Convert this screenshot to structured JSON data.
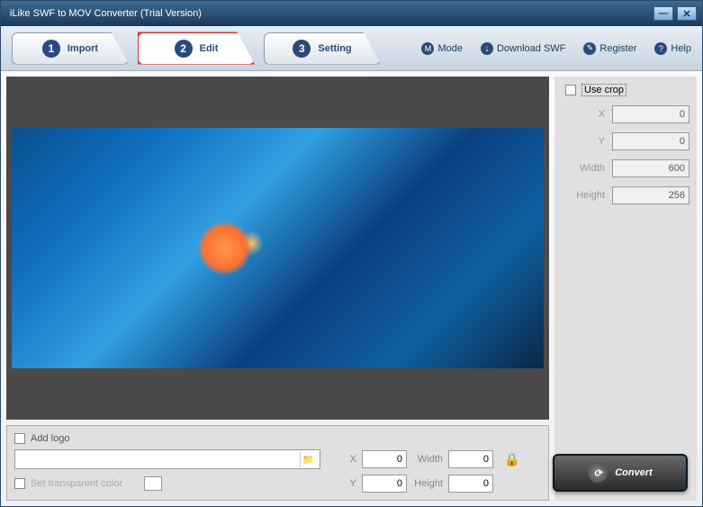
{
  "window": {
    "title": "iLike SWF to MOV Converter (Trial Version)"
  },
  "tabs": [
    {
      "num": "1",
      "label": "Import"
    },
    {
      "num": "2",
      "label": "Edit"
    },
    {
      "num": "3",
      "label": "Setting"
    }
  ],
  "menu": {
    "mode": "Mode",
    "download": "Download SWF",
    "register": "Register",
    "help": "Help"
  },
  "crop": {
    "use_crop_label": "Use crop",
    "x_label": "X",
    "x_value": "0",
    "y_label": "Y",
    "y_value": "0",
    "width_label": "Width",
    "width_value": "600",
    "height_label": "Height",
    "height_value": "256"
  },
  "logo": {
    "add_logo_label": "Add logo",
    "path": "",
    "x_label": "X",
    "x_value": "0",
    "y_label": "Y",
    "y_value": "0",
    "width_label": "Width",
    "width_value": "0",
    "height_label": "Height",
    "height_value": "0",
    "transparent_label": "Set transparent color"
  },
  "convert_label": "Convert",
  "icons": {
    "mode": "M",
    "download": "↓",
    "register": "✎",
    "help": "?",
    "browse": "📁",
    "convert": "⟳",
    "lock": "🔒"
  }
}
